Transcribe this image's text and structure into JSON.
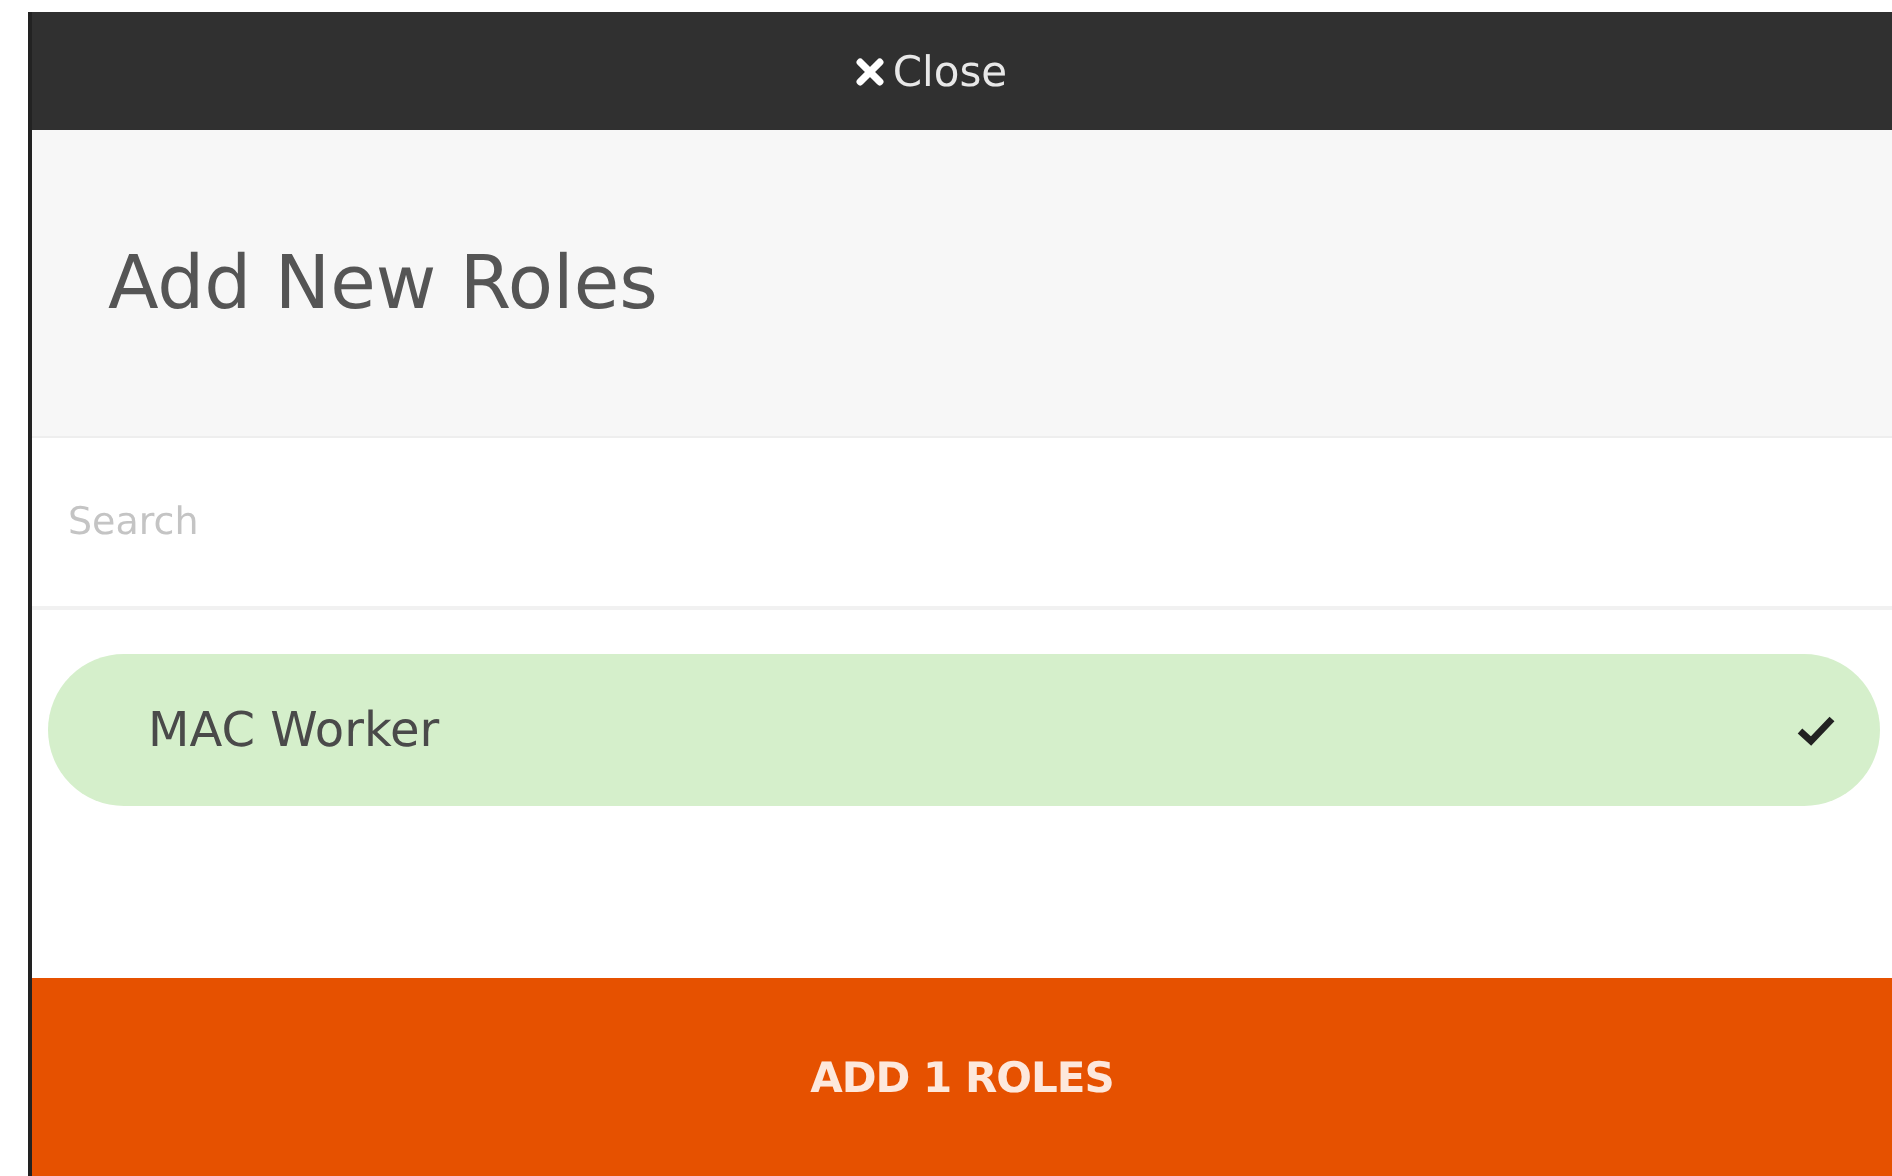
{
  "close_button": {
    "label": "Close"
  },
  "header": {
    "title": "Add New Roles"
  },
  "search": {
    "placeholder": "Search"
  },
  "roles": [
    {
      "label": "MAC Worker",
      "selected": true
    }
  ],
  "submit_button": {
    "label": "ADD 1 ROLES"
  }
}
